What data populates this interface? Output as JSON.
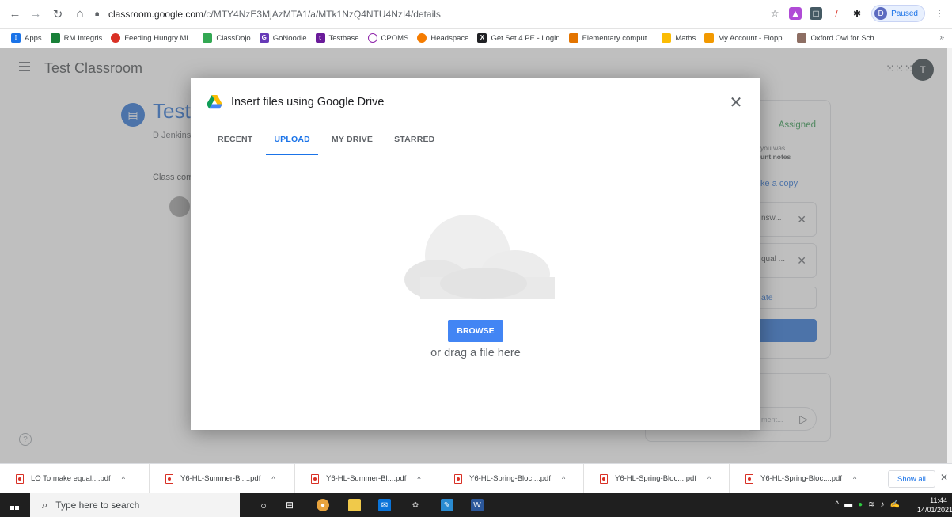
{
  "browser": {
    "url_host": "classroom.google.com",
    "url_path": "/c/MTY4NzE3MjAzMTA1/a/MTk1NzQ4NTU4NzI4/details",
    "profile_initial": "D",
    "profile_status": "Paused"
  },
  "bookmarks": [
    {
      "label": "Apps",
      "icon": "apps-grid-icon",
      "color": "#1a73e8"
    },
    {
      "label": "RM Integris",
      "icon": "rm-integris-icon",
      "color": "#188038"
    },
    {
      "label": "Feeding Hungry Mi...",
      "icon": "feeding-hungry-icon",
      "color": "#d93025"
    },
    {
      "label": "ClassDojo",
      "icon": "classdojo-icon",
      "color": "#33a853"
    },
    {
      "label": "GoNoodle",
      "icon": "gonoodle-icon",
      "color": "#673ab7"
    },
    {
      "label": "Testbase",
      "icon": "testbase-icon",
      "color": "#6a1b9a"
    },
    {
      "label": "CPOMS",
      "icon": "cpoms-icon",
      "color": "#8e24aa"
    },
    {
      "label": "Headspace",
      "icon": "headspace-icon",
      "color": "#f57c00"
    },
    {
      "label": "Get Set 4 PE - Login",
      "icon": "getset4pe-icon",
      "color": "#202124"
    },
    {
      "label": "Elementary comput...",
      "icon": "elementary-icon",
      "color": "#e37400"
    },
    {
      "label": "Maths",
      "icon": "folder-icon",
      "color": "#fbbc04"
    },
    {
      "label": "My Account - Flopp...",
      "icon": "floppy-icon",
      "color": "#f29900"
    },
    {
      "label": "Oxford Owl for Sch...",
      "icon": "oxford-owl-icon",
      "color": "#8d6e63"
    }
  ],
  "classroom": {
    "class_name": "Test Classroom",
    "assignment_title": "Test",
    "author": "D Jenkins",
    "class_comments": "Class comments",
    "user_initial": "T",
    "status": "Assigned",
    "side_text_line1": "you was",
    "side_text_line2": "unt notes",
    "make_copy": "ke a copy",
    "file1": "nsw...",
    "file2": "qual ...",
    "create_label": "ate",
    "comment_placeholder": "ment..."
  },
  "dialog": {
    "title": "Insert files using Google Drive",
    "tabs": [
      "RECENT",
      "UPLOAD",
      "MY DRIVE",
      "STARRED"
    ],
    "active_tab": "UPLOAD",
    "browse_label": "BROWSE",
    "drag_text": "or drag a file here"
  },
  "downloads": {
    "items": [
      "LO To make equal....pdf",
      "Y6-HL-Summer-Bl....pdf",
      "Y6-HL-Summer-Bl....pdf",
      "Y6-HL-Spring-Bloc....pdf",
      "Y6-HL-Spring-Bloc....pdf",
      "Y6-HL-Spring-Bloc....pdf"
    ],
    "show_all": "Show all"
  },
  "taskbar": {
    "search_placeholder": "Type here to search",
    "time": "11:44",
    "date": "14/01/2021"
  },
  "colors": {
    "accent": "#1a73e8",
    "browse_button": "#4285f4",
    "classroom_blue": "#1967d2",
    "assigned_green": "#1e8e3e"
  }
}
